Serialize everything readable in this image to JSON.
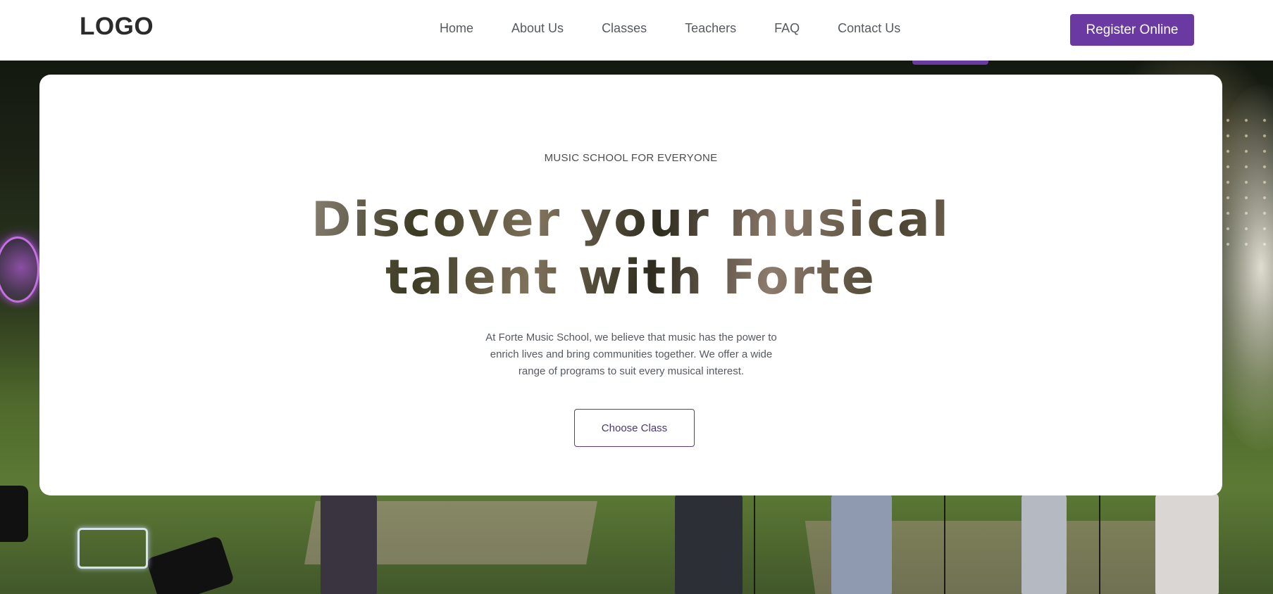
{
  "header": {
    "logo": "LOGO",
    "nav": [
      "Home",
      "About Us",
      "Classes",
      "Teachers",
      "FAQ",
      "Contact Us"
    ],
    "register_label": "Register Online"
  },
  "hero": {
    "eyebrow": "MUSIC SCHOOL FOR EVERYONE",
    "headline_line1": "Discover your musical",
    "headline_line2": "talent with Forte",
    "description": "At Forte Music School, we believe that music has the power to enrich lives and bring communities together. We offer a wide range of programs to suit every musical interest.",
    "cta_label": "Choose Class"
  },
  "colors": {
    "accent": "#6a3aa2",
    "text": "#555a60",
    "card": "#ffffff"
  },
  "background": {
    "image_icon": "concert-photo"
  }
}
